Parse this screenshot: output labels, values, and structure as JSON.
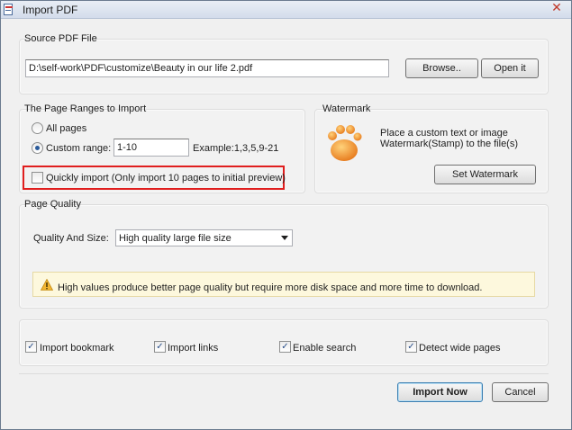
{
  "window": {
    "title": "Import PDF"
  },
  "source": {
    "legend": "Source PDF File",
    "path": "D:\\self-work\\PDF\\customize\\Beauty in our life 2.pdf",
    "browse": "Browse..",
    "open": "Open it"
  },
  "ranges": {
    "legend": "The Page Ranges to Import",
    "all_pages": "All pages",
    "custom_range": "Custom range:",
    "custom_value": "1-10",
    "example": "Example:1,3,5,9-21",
    "quick_import": "Quickly import (Only import 10 pages to  initial  preview)"
  },
  "watermark": {
    "legend": "Watermark",
    "desc_line1": "Place a custom text or image",
    "desc_line2": "Watermark(Stamp) to the file(s)",
    "button": "Set Watermark"
  },
  "quality": {
    "legend": "Page Quality",
    "label": "Quality And Size:",
    "selected": "High quality large file size",
    "notice": "High values produce better page quality but require more disk space and more time to download."
  },
  "options": {
    "import_bookmark": "Import bookmark",
    "import_links": "Import links",
    "enable_search": "Enable search",
    "detect_wide_pages": "Detect wide pages"
  },
  "footer": {
    "import_now": "Import Now",
    "cancel": "Cancel"
  },
  "colors": {
    "highlight": "#e01e1e",
    "accent": "#3c7fb1"
  }
}
